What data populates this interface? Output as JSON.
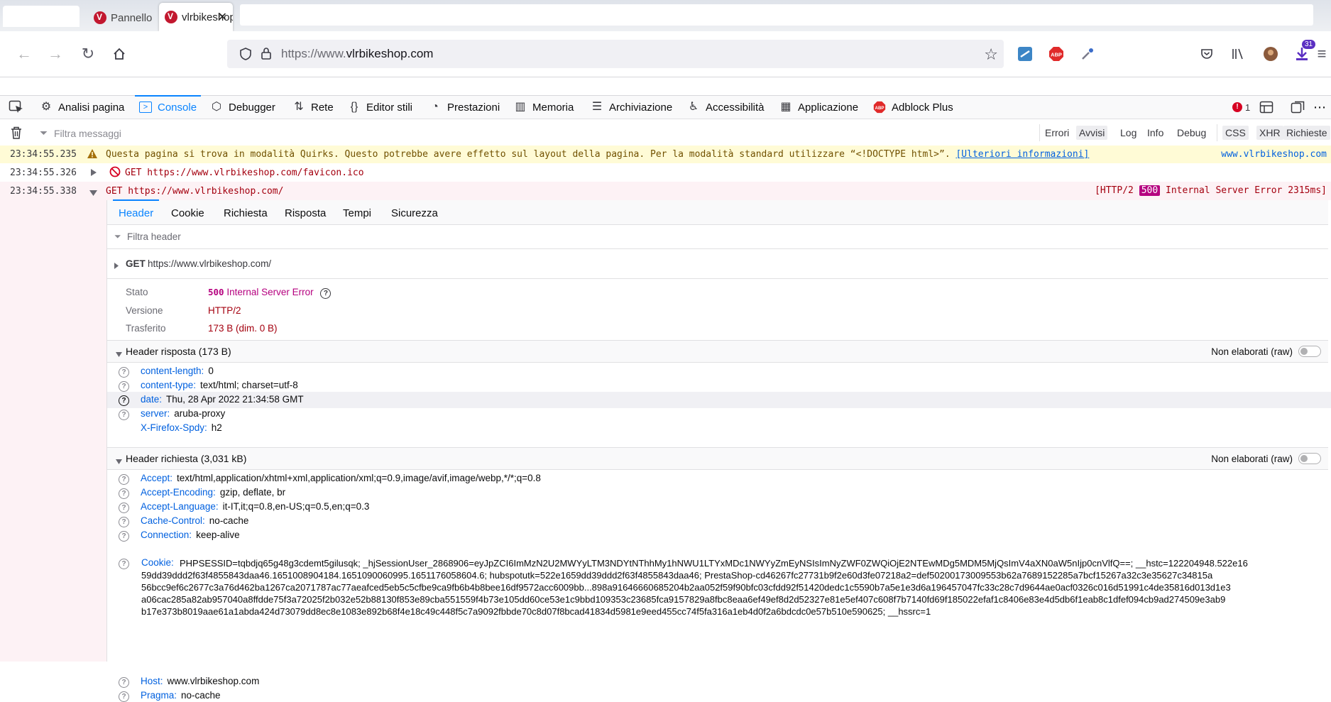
{
  "browser": {
    "tabs": [
      {
        "label": "Pannello"
      },
      {
        "label": "vlrbikeshop",
        "active": true
      }
    ],
    "url": {
      "prefix": "https://www.",
      "host": "vlrbikeshop.com"
    },
    "notification_count": "31"
  },
  "devtools": {
    "tabs": [
      "Analisi pagina",
      "Console",
      "Debugger",
      "Rete",
      "Editor stili",
      "Prestazioni",
      "Memoria",
      "Archiviazione",
      "Accessibilità",
      "Applicazione",
      "Adblock Plus"
    ],
    "active_tab": "Console",
    "error_count": "1",
    "filter_placeholder": "Filtra messaggi",
    "levels": [
      "Errori",
      "Avvisi",
      "Log",
      "Info",
      "Debug"
    ],
    "types": [
      "CSS",
      "XHR",
      "Richieste"
    ]
  },
  "console": {
    "warning": {
      "time": "23:34:55.235",
      "text": "Questa pagina si trova in modalità Quirks. Questo potrebbe avere effetto sul layout della pagina. Per la modalità standard utilizzare “<!DOCTYPE html>”.",
      "link": "[Ulteriori informazioni]",
      "source": "www.vlrbikeshop.com"
    },
    "blocked": {
      "time": "23:34:55.326",
      "text": "GET https://www.vlrbikeshop.com/favicon.ico"
    },
    "request": {
      "time": "23:34:55.338",
      "text": "GET https://www.vlrbikeshop.com/",
      "status_prefix": "[HTTP/2",
      "status_code": "500",
      "status_suffix": "Internal Server Error 2315ms]"
    }
  },
  "netpanel": {
    "tabs": [
      "Header",
      "Cookie",
      "Richiesta",
      "Risposta",
      "Tempi",
      "Sicurezza"
    ],
    "filter_placeholder": "Filtra header",
    "summary": {
      "method": "GET",
      "url": "https://www.vlrbikeshop.com/"
    },
    "stato_label": "Stato",
    "stato_code": "500",
    "stato_text": "Internal Server Error",
    "versione_label": "Versione",
    "versione": "HTTP/2",
    "trasferito_label": "Trasferito",
    "trasferito": "173 B (dim. 0 B)",
    "raw_label": "Non elaborati (raw)",
    "response_title": "Header risposta (173 B)",
    "response_headers": [
      {
        "k": "content-length:",
        "v": "0"
      },
      {
        "k": "content-type:",
        "v": "text/html; charset=utf-8"
      },
      {
        "k": "date:",
        "v": "Thu, 28 Apr 2022 21:34:58 GMT"
      },
      {
        "k": "server:",
        "v": "aruba-proxy"
      },
      {
        "k": "X-Firefox-Spdy:",
        "v": "h2"
      }
    ],
    "request_title": "Header richiesta (3,031 kB)",
    "request_headers": [
      {
        "k": "Accept:",
        "v": "text/html,application/xhtml+xml,application/xml;q=0.9,image/avif,image/webp,*/*;q=0.8"
      },
      {
        "k": "Accept-Encoding:",
        "v": "gzip, deflate, br"
      },
      {
        "k": "Accept-Language:",
        "v": "it-IT,it;q=0.8,en-US;q=0.5,en;q=0.3"
      },
      {
        "k": "Cache-Control:",
        "v": "no-cache"
      },
      {
        "k": "Connection:",
        "v": "keep-alive"
      }
    ],
    "cookie_key": "Cookie:",
    "cookie_lines": [
      "PHPSESSID=tqbdjq65g48g3cdemt5gilusqk; _hjSessionUser_2868906=eyJpZCI6ImMzN2U2MWYyLTM3NDYtNThhMy1hNWU1LTYxMDc1NWYyZmEyNSIsImNyZWF0ZWQiOjE2NTEwMDg5MDM5MjQsImV4aXN0aW5nIjp0cnVlfQ==; __hstc=122204948.522e16",
      "59dd39ddd2f63f4855843daa46.1651008904184.1651090060995.1651176058604.6; hubspotutk=522e1659dd39ddd2f63f4855843daa46; PrestaShop-cd46267fc27731b9f2e60d3fe07218a2=def50200173009553b62a7689152285a7bcf15267a32c3e35627c34815a",
      "56bcc9ef6c2677c3a76d462ba1267ca2071787ac77aeafced5eb5c5cfbe9ca9fb6b4b8bee16df9572acc6009bb...898a91646660685204b2aa052f59f90bfc03cfdd92f51420dedc1c5590b7a5e1e3d6a196457047fc33c28c7d9644ae0acf0326c016d51991c4de35816d013d1e3",
      "a06cac285a82ab957040a8ffdde75f3a72025f2b032e52b88130f853e89cba551559f4b73e105dd60ce53e1c9bbd109353c23685fca9157829a8fbc8eaa6ef49ef8d2d52327e81e5ef407c608f7b7140fd69f185022efaf1c8406e83e4d5db6f1eab8c1dfef094cb9ad274509e3ab9",
      "b17e373b8019aae61a1abda424d73079dd8ec8e1083e892b68f4e18c49c448f5c7a9092fbbde70c8d07f8bcad41834d5981e9eed455cc74f5fa316a1eb4d0f2a6bdcdc0e57b510e590625; __hssrc=1"
    ],
    "request_headers_tail": [
      {
        "k": "Host:",
        "v": "www.vlrbikeshop.com"
      },
      {
        "k": "Pragma:",
        "v": "no-cache"
      }
    ]
  }
}
